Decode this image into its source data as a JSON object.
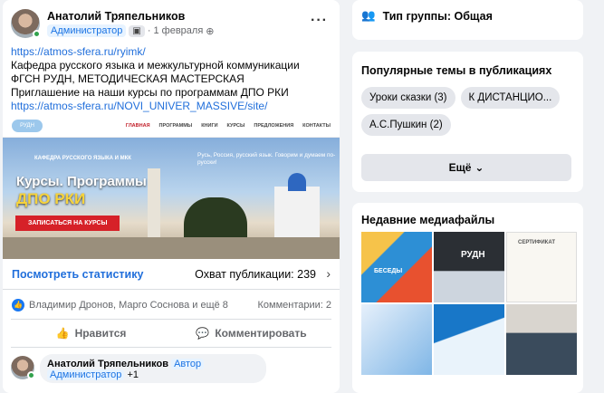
{
  "post": {
    "author": "Анатолий Тряпельников",
    "role": "Администратор",
    "date": "1 февраля",
    "date_sep": "·",
    "more_icon": "···",
    "lines": [
      "https://atmos-sfera.ru/ryimk/",
      "Кафедра русского языка и межкультурной коммуникации",
      "ФГСН РУДН, МЕТОДИЧЕСКАЯ МАСТЕРСКАЯ",
      "Приглашение на наши курсы по программам ДПО РКИ",
      "https://atmos-sfera.ru/NOVI_UNIVER_MASSIVE/site/"
    ],
    "site": {
      "logo": "РУДН",
      "menu": [
        "ГЛАВНАЯ",
        "ПРОГРАММЫ",
        "КНИГИ",
        "КУРСЫ",
        "ПРЕДЛОЖЕНИЯ",
        "КОНТАКТЫ"
      ],
      "tagline": "КАФЕДРА РУССКОГО ЯЗЫКА И МКК",
      "headline": "Курсы. Программы",
      "headline2": "ДПО РКИ",
      "motto": "Русь, Россия, русский язык. Говорим и думаем по-русски!",
      "cta": "ЗАПИСАТЬСЯ НА КУРСЫ"
    },
    "stats": {
      "view_label": "Посмотреть статистику",
      "reach_label": "Охват публикации: 239",
      "chevron": "›"
    },
    "reactions": {
      "names": "Владимир Дронов, Марго Соснова и ещё 8",
      "comments": "Комментарии: 2"
    },
    "actions": {
      "like": "Нравится",
      "comment": "Комментировать"
    },
    "comment": {
      "author": "Анатолий Тряпельников",
      "tag1": "Автор",
      "tag2": "Администратор",
      "extra": "+1"
    }
  },
  "sidebar": {
    "group_type": "Тип группы: Общая",
    "topics_title": "Популярные темы в публикациях",
    "topics": [
      "Уроки сказки (3)",
      "К ДИСТАНЦИО...",
      "А.С.Пушкин (2)"
    ],
    "more_label": "Ещё",
    "media_title": "Недавние медиафайлы",
    "media_captions": [
      "БЕСЕДЫ",
      "РУДН",
      "СЕРТИФИКАТ",
      "",
      "",
      ""
    ]
  },
  "colors": {
    "accent": "#1877f2",
    "link": "#216fdb",
    "cta": "#d62128"
  }
}
